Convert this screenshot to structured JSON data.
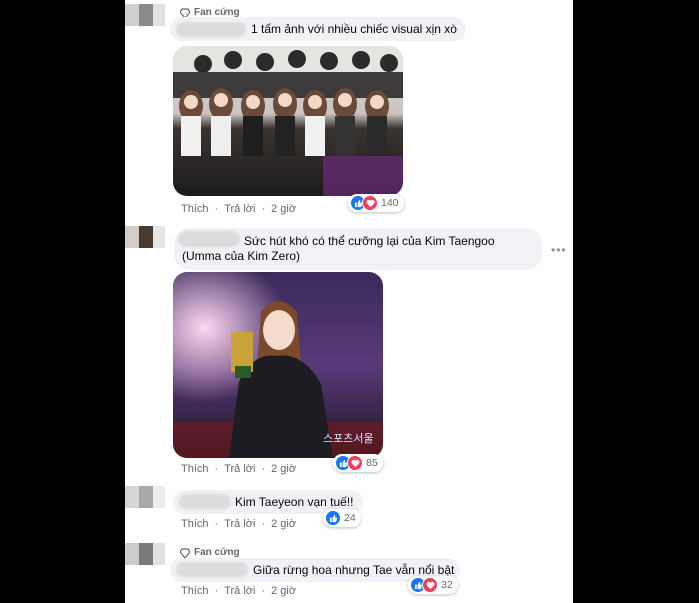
{
  "badge_label": "Fan cứng",
  "actions": {
    "like": "Thích",
    "reply": "Trả lời"
  },
  "more_menu": "•••",
  "comments": [
    {
      "text": "1 tấm ảnh với nhiều chiếc visual xịn xò",
      "time": "2 giờ",
      "reactions": "140"
    },
    {
      "text": "Sức hút khó có thể cưỡng lại của Kim Taengoo (Umma của Kim Zero)",
      "time": "2 giờ",
      "reactions": "85"
    },
    {
      "text": "Kim Taeyeon vạn tuế!!",
      "time": "2 giờ",
      "reactions": "24"
    },
    {
      "text": "Giữa rừng hoa nhưng Tae vẫn nổi bật",
      "time": "2 giờ",
      "reactions": "32"
    }
  ],
  "photo_watermark": "스포츠서울",
  "colors": {
    "like": "#1877f2",
    "heart": "#f33e58",
    "bubble": "#f0f2f5",
    "badge_text": "#65676b"
  }
}
